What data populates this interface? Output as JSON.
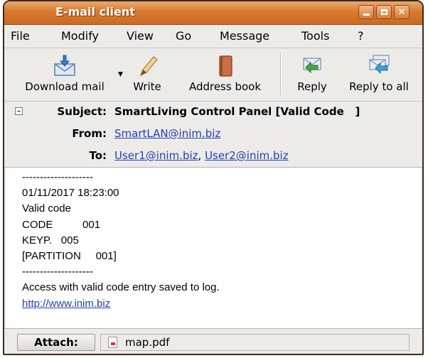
{
  "window": {
    "title": "E-mail client"
  },
  "menu": [
    "File",
    "Modify",
    "View",
    "Go",
    "Message",
    "Tools",
    "?"
  ],
  "toolbar": {
    "download": "Download mail",
    "write": "Write",
    "address_book": "Address  book",
    "reply": "Reply",
    "reply_all": "Reply to all"
  },
  "header": {
    "subject_label": "Subject:",
    "subject": "SmartLiving Control Panel [Valid Code   ]",
    "from_label": "From:",
    "from": "SmartLAN@inim.biz",
    "to_label": "To:",
    "to_1": "User1@inim.biz",
    "to_sep": ", ",
    "to_2": "User2@inim.biz"
  },
  "body": {
    "lines": [
      "--------------------",
      "01/11/2017 18:23:00",
      "Valid code",
      "CODE          001",
      "KEYP.   005",
      "[PARTITION     001]",
      "--------------------",
      "Access with valid code entry saved to log."
    ],
    "link": "http://www.inim.biz"
  },
  "attachments": {
    "label": "Attach:",
    "file": "map.pdf"
  },
  "icons": {
    "download": "download-mail-icon",
    "write": "pencil-icon",
    "address_book": "address-book-icon",
    "reply": "reply-icon",
    "reply_all": "reply-all-icon",
    "attachment": "pdf-file-icon"
  },
  "colors": {
    "titlebar": "#d9792f",
    "link": "#2340b3",
    "window_bg": "#ecebe8"
  }
}
